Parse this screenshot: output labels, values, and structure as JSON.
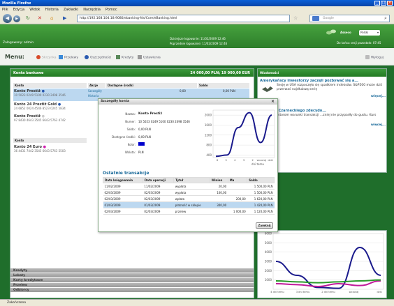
{
  "browser": {
    "title": "Mozilla Firefox",
    "menu": [
      "Plik",
      "Edycja",
      "Widok",
      "Historia",
      "Zakładki",
      "Narzędzia",
      "Pomoc"
    ],
    "url": "http://192.168.104.18:9080/ebanking-fds/Core/eBanking.html",
    "search_placeholder": "Google",
    "status": "Zakończono"
  },
  "header": {
    "user_label": "Zalogowany: admin",
    "login_now": "Dzisiejsze logowanie: 11/02/2009 12:46",
    "login_last": "Poprzednie logowanie: 11/02/2009 12:46",
    "brand": "Asseco",
    "language": "Polski",
    "session": "Do końca sesji pozostało: 07:45"
  },
  "app_menu": {
    "title": "Menu:",
    "items": [
      {
        "label": "Skrzynka",
        "dim": true
      },
      {
        "label": "Przelewy",
        "dim": false
      },
      {
        "label": "Oszczędności",
        "dim": false
      },
      {
        "label": "Kredyty",
        "dim": false
      },
      {
        "label": "Ustawienia",
        "dim": false
      }
    ],
    "logout": "Wyloguj"
  },
  "accounts": {
    "title": "Konta bankowe",
    "summary": "24 000,00 PLN; 19 000,00 EUR",
    "col_konto": "Konto",
    "col_akcje": "Akcje",
    "col_srodki": "Dostępne środki",
    "col_saldo": "Saldo",
    "items": [
      {
        "name": "Konto Prestiż",
        "number": "10 5023 0249 5100 0230 2498 3546",
        "selected": true
      },
      {
        "name": "Konto 24 Prestiż Gold",
        "number": "24 6852 0024 4546 8523 0245 5834",
        "selected": false
      },
      {
        "name": "Konto Prestiż",
        "number": "97 8430 4643 3545 6643 5763 4742",
        "selected": false
      },
      {
        "name": "Konto",
        "number": "",
        "selected": false
      },
      {
        "name": "Konto 24 Euro",
        "number": "36 4431 7442 3545 6643 5763 5503",
        "selected": false
      }
    ],
    "actions_first": [
      "Szczegóły",
      "Historia"
    ],
    "row1_values": {
      "srodki": "0,00",
      "saldo": "0,00 PLN"
    },
    "bottom_sections": [
      "Kredyty",
      "Lokaty",
      "Karty kredytowe",
      "Przelew",
      "Odbiorcy"
    ]
  },
  "news": {
    "title": "Wiadomości",
    "items": [
      {
        "headline": "Amerykańscy inwestorzy zaczęli pozbywać się a...",
        "body": "Sesję w USA rozpoczęło się spadkiem indeksów. S&P500 może dziś przerwać najdłuższą serię",
        "more": "więcej..."
      },
      {
        "headline": "...Leszka Czarneckiego zdecydo...",
        "body": "...nym inwestorom warunki transakcji ...zniej nie przypadły do gustu. Kurs Noble",
        "more": "więcej..."
      }
    ]
  },
  "modal": {
    "title": "Szczegóły konta",
    "fields": [
      {
        "label": "Nazwa:",
        "value": "Konto Prestiż"
      },
      {
        "label": "Numer:",
        "value": "10 5023 0249 5100 0230 2498 3546"
      },
      {
        "label": "Saldo:",
        "value": "0,00 PLN"
      },
      {
        "label": "Dostępne środki:",
        "value": "0,00 PLN"
      },
      {
        "label": "Kolor:",
        "value": ""
      },
      {
        "label": "Waluta:",
        "value": "PLN"
      }
    ],
    "tx_title": "Ostatnie transakcje",
    "tx_columns": [
      "Data księgowania",
      "Data operacji",
      "Tytuł",
      "Winien",
      "Ma",
      "Saldo"
    ],
    "tx_rows": [
      [
        "11/02/2009",
        "11/02/2009",
        "wypłata",
        "20,00",
        "",
        "1 500,00 PLN"
      ],
      [
        "02/03/2009",
        "02/03/2009",
        "wypłata",
        "100,00",
        "",
        "1 500,00 PLN"
      ],
      [
        "02/03/2009",
        "02/03/2009",
        "wpłata",
        "",
        "200,00",
        "1 620,00 PLN"
      ],
      [
        "01/03/2009",
        "01/03/2009",
        "płatność w sklepie",
        "300,00",
        "",
        "1 420,00 PLN"
      ],
      [
        "02/03/2009",
        "02/03/2009",
        "przelew",
        "",
        "1 000,00",
        "1 120,00 PLN"
      ]
    ],
    "highlight_row": 3,
    "close_label": "Zamknij"
  },
  "chart_data": [
    {
      "type": "line",
      "x": [
        6,
        5,
        4,
        3,
        2,
        1
      ],
      "xticks": [
        "6",
        "5",
        "4",
        "3",
        "2",
        "wczoraj",
        "dziś"
      ],
      "xlabel": "dni temu",
      "ylim": [
        300,
        2200
      ],
      "yticks": [
        400,
        800,
        1200,
        1600,
        2000
      ],
      "series": [
        {
          "color": "#1a1a8c",
          "values": [
            350,
            400,
            1500,
            2100,
            900,
            2000
          ]
        }
      ]
    },
    {
      "type": "line",
      "xticks": [
        "4 dni temu",
        "3 dni temu",
        "2 dni temu",
        "wczoraj",
        "dziś"
      ],
      "ylim": [
        0,
        6000
      ],
      "yticks": [
        1000,
        2000,
        3000,
        4000,
        5000,
        6000
      ],
      "series": [
        {
          "color": "#1a1a8c",
          "values": [
            3000,
            1500,
            200,
            100,
            4500,
            1500
          ]
        },
        {
          "color": "#c01a9a",
          "values": [
            600,
            500,
            300,
            600,
            400,
            900
          ]
        },
        {
          "color": "#2a9a2a",
          "values": [
            900,
            800,
            700,
            800,
            900,
            1000
          ]
        }
      ]
    }
  ],
  "colors": {
    "accent": "#2d7d2a",
    "link": "#1a6a9a",
    "selection": "#bcd8f0",
    "account_color": "#0000cc"
  }
}
